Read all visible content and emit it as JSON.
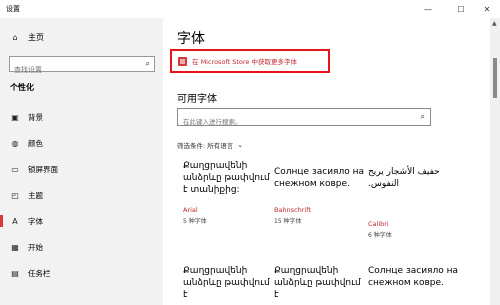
{
  "window": {
    "title": "设置",
    "min_glyph": "—",
    "max_glyph": "☐",
    "close_glyph": "✕"
  },
  "sidebar": {
    "home_label": "主页",
    "search_placeholder": "查找设置",
    "section_title": "个性化",
    "items": [
      {
        "label": "背景",
        "icon": "image-icon",
        "glyph": "▣"
      },
      {
        "label": "颜色",
        "icon": "palette-icon",
        "glyph": "◍"
      },
      {
        "label": "锁屏界面",
        "icon": "lock-screen-icon",
        "glyph": "▭"
      },
      {
        "label": "主题",
        "icon": "theme-icon",
        "glyph": "◰"
      },
      {
        "label": "字体",
        "icon": "font-icon",
        "glyph": "A"
      },
      {
        "label": "开始",
        "icon": "start-icon",
        "glyph": "▦"
      },
      {
        "label": "任务栏",
        "icon": "taskbar-icon",
        "glyph": "▤"
      }
    ],
    "active_index": 4
  },
  "main": {
    "page_title": "字体",
    "store_link": "在 Microsoft Store 中获取更多字体",
    "available_title": "可用字体",
    "font_search_placeholder": "在此键入进行搜索。",
    "filter_label": "筛选条件: 所有语言",
    "cards": [
      {
        "preview": "Քաղցրավենի անձրևը թափվում է տանիքից:",
        "name": "Arial",
        "count": "5 种字体"
      },
      {
        "preview": "Солнце засияло на снежном ковре.",
        "name": "Bahnschrift",
        "count": "15 种字体"
      },
      {
        "preview": "حفيف الأشجار يريح النفوس.",
        "name": "Calibri",
        "count": "6 种字体"
      },
      {
        "preview": "Քաղցրավենի անձրևը թափվում է",
        "name": "",
        "count": ""
      },
      {
        "preview": "Քաղցրավենի անձրևը թափվում է",
        "name": "",
        "count": ""
      },
      {
        "preview": "Солнце засияло на снежном ковре.",
        "name": "",
        "count": ""
      }
    ]
  },
  "colors": {
    "accent": "#c0282d",
    "highlight_box": "#e8141a"
  }
}
